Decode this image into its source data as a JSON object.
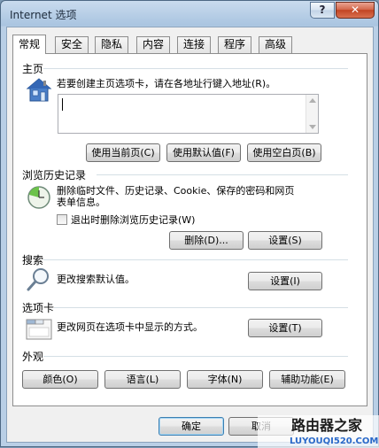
{
  "window": {
    "title": "Internet 选项",
    "help_label": "?",
    "close_label": "✕"
  },
  "tabs": [
    {
      "label": "常规",
      "active": true
    },
    {
      "label": "安全"
    },
    {
      "label": "隐私"
    },
    {
      "label": "内容"
    },
    {
      "label": "连接"
    },
    {
      "label": "程序"
    },
    {
      "label": "高级"
    }
  ],
  "homepage": {
    "section_label": "主页",
    "description": "若要创建主页选项卡，请在各地址行键入地址(R)。",
    "address_value": "",
    "buttons": [
      "使用当前页(C)",
      "使用默认值(F)",
      "使用空白页(B)"
    ]
  },
  "history": {
    "section_label": "浏览历史记录",
    "description_line1": "删除临时文件、历史记录、Cookie、保存的密码和网页",
    "description_line2": "表单信息。",
    "checkbox_label": "退出时删除浏览历史记录(W)",
    "checkbox_checked": false,
    "delete_button": "删除(D)...",
    "settings_button": "设置(S)"
  },
  "search": {
    "section_label": "搜索",
    "description": "更改搜索默认值。",
    "settings_button": "设置(I)"
  },
  "tabs_section": {
    "section_label": "选项卡",
    "description": "更改网页在选项卡中显示的方式。",
    "settings_button": "设置(T)"
  },
  "appearance": {
    "section_label": "外观",
    "buttons": [
      "颜色(O)",
      "语言(L)",
      "字体(N)",
      "辅助功能(E)"
    ]
  },
  "footer": {
    "ok": "确定",
    "cancel": "取消"
  },
  "watermark": {
    "brand": "路由器之家",
    "url": "LUYOUQI520.COM"
  }
}
